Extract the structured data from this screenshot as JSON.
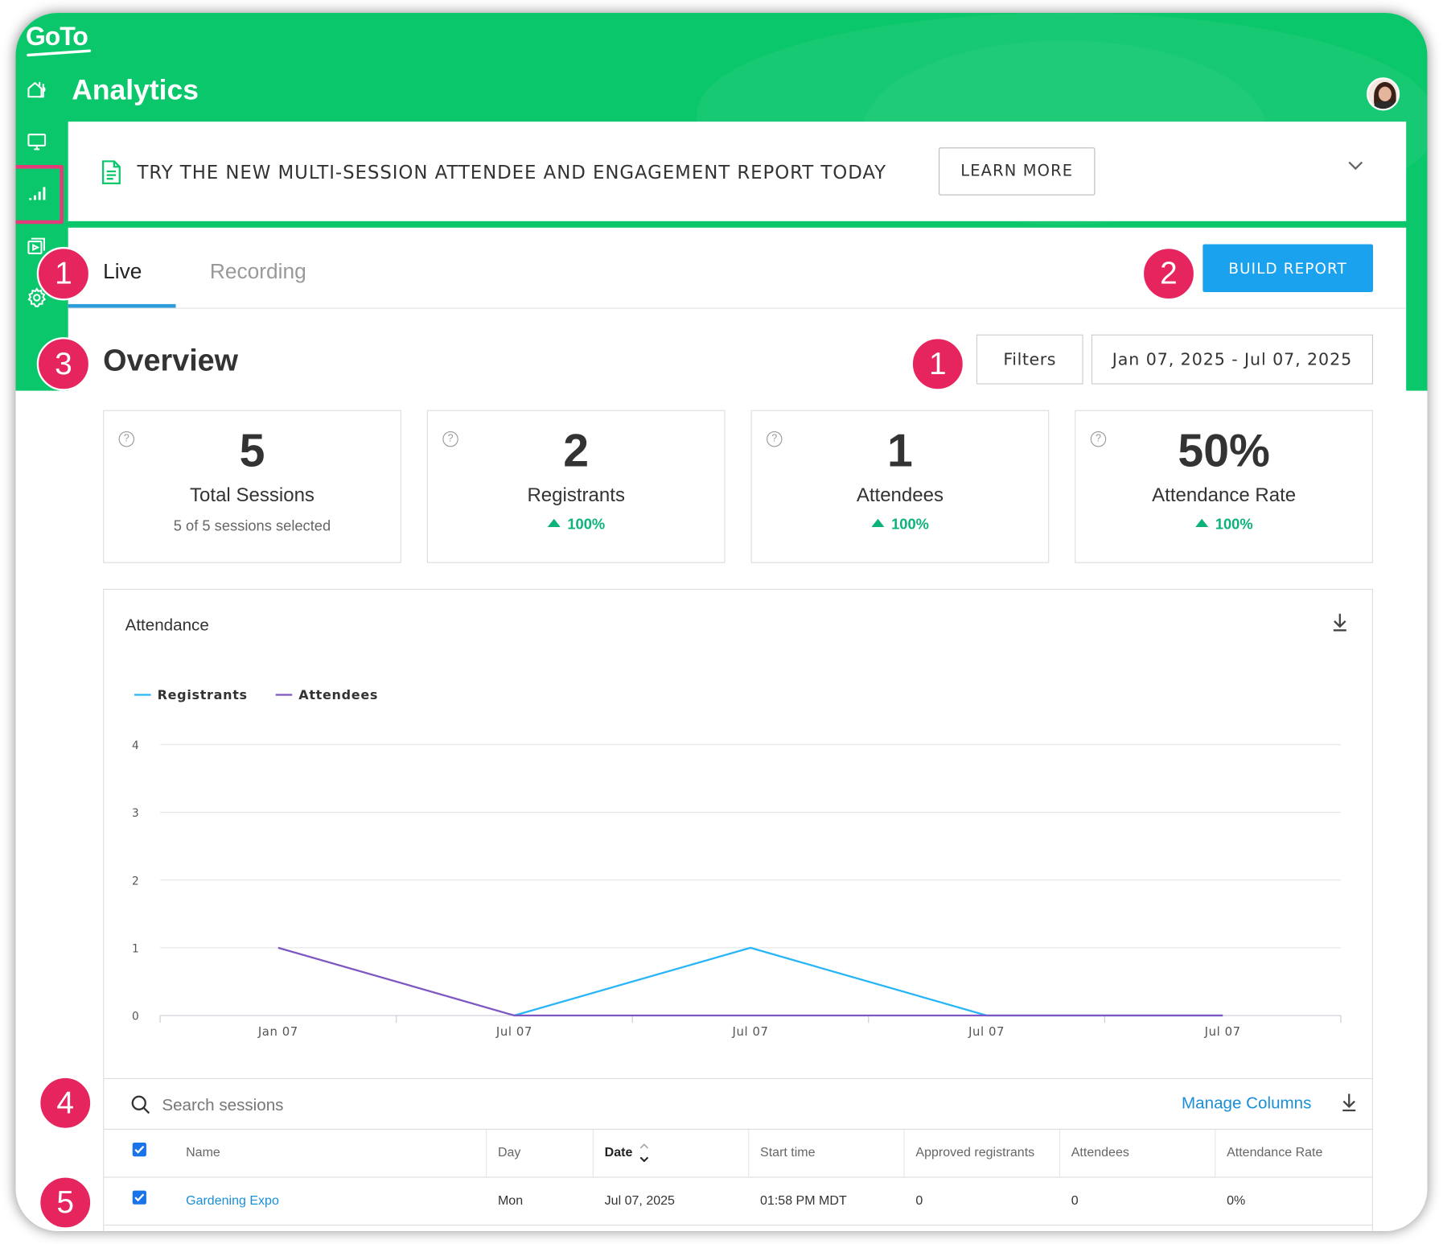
{
  "app": {
    "logo_text": "GoTo",
    "page_title": "Analytics"
  },
  "sidebar": {
    "items": [
      {
        "name": "home",
        "icon": "home-icon"
      },
      {
        "name": "webinars",
        "icon": "monitor-icon"
      },
      {
        "name": "analytics",
        "icon": "bar-chart-icon",
        "active": true
      },
      {
        "name": "recordings",
        "icon": "video-library-icon"
      },
      {
        "name": "settings",
        "icon": "gear-icon"
      }
    ]
  },
  "banner": {
    "text": "TRY THE NEW MULTI-SESSION ATTENDEE AND ENGAGEMENT REPORT TODAY",
    "button_label": "LEARN MORE"
  },
  "tabs": [
    {
      "label": "Live",
      "active": true
    },
    {
      "label": "Recording",
      "active": false
    }
  ],
  "toolbar": {
    "build_report_label": "BUILD REPORT",
    "filters_label": "Filters",
    "date_range": "Jan 07, 2025 - Jul 07, 2025"
  },
  "overview": {
    "title": "Overview",
    "kpis": [
      {
        "value": "5",
        "label": "Total Sessions",
        "sub": "5 of 5 sessions selected"
      },
      {
        "value": "2",
        "label": "Registrants",
        "delta": "100%"
      },
      {
        "value": "1",
        "label": "Attendees",
        "delta": "100%"
      },
      {
        "value": "50%",
        "label": "Attendance Rate",
        "delta": "100%"
      }
    ]
  },
  "badges": [
    "1",
    "2",
    "3",
    "1",
    "4",
    "5"
  ],
  "chart_data": {
    "type": "line",
    "title": "Attendance",
    "categories": [
      "Jan 07",
      "Jul 07",
      "Jul 07",
      "Jul 07",
      "Jul 07"
    ],
    "series": [
      {
        "name": "Registrants",
        "color": "#29b6f6",
        "values": [
          null,
          0,
          1,
          0,
          0
        ]
      },
      {
        "name": "Attendees",
        "color": "#7e57c2",
        "values": [
          1,
          0,
          0,
          0,
          0
        ]
      }
    ],
    "y_ticks": [
      "0",
      "1",
      "2",
      "3",
      "4"
    ],
    "ylim": [
      0,
      4
    ],
    "grid": true,
    "legend": "top-left"
  },
  "table": {
    "search_placeholder": "Search sessions",
    "manage_columns_label": "Manage Columns",
    "columns": [
      "Name",
      "Day",
      "Date",
      "Start time",
      "Approved registrants",
      "Attendees",
      "Attendance Rate"
    ],
    "rows": [
      {
        "name": "Gardening Expo",
        "day": "Mon",
        "date": "Jul 07, 2025",
        "start": "01:58 PM MDT",
        "approved": "0",
        "attendees": "0",
        "rate": "0%"
      }
    ]
  },
  "colors": {
    "brand_green": "#0bc76b",
    "accent_blue": "#1ba2ef",
    "badge_pink": "#e6245e",
    "positive": "#0bb37a"
  }
}
